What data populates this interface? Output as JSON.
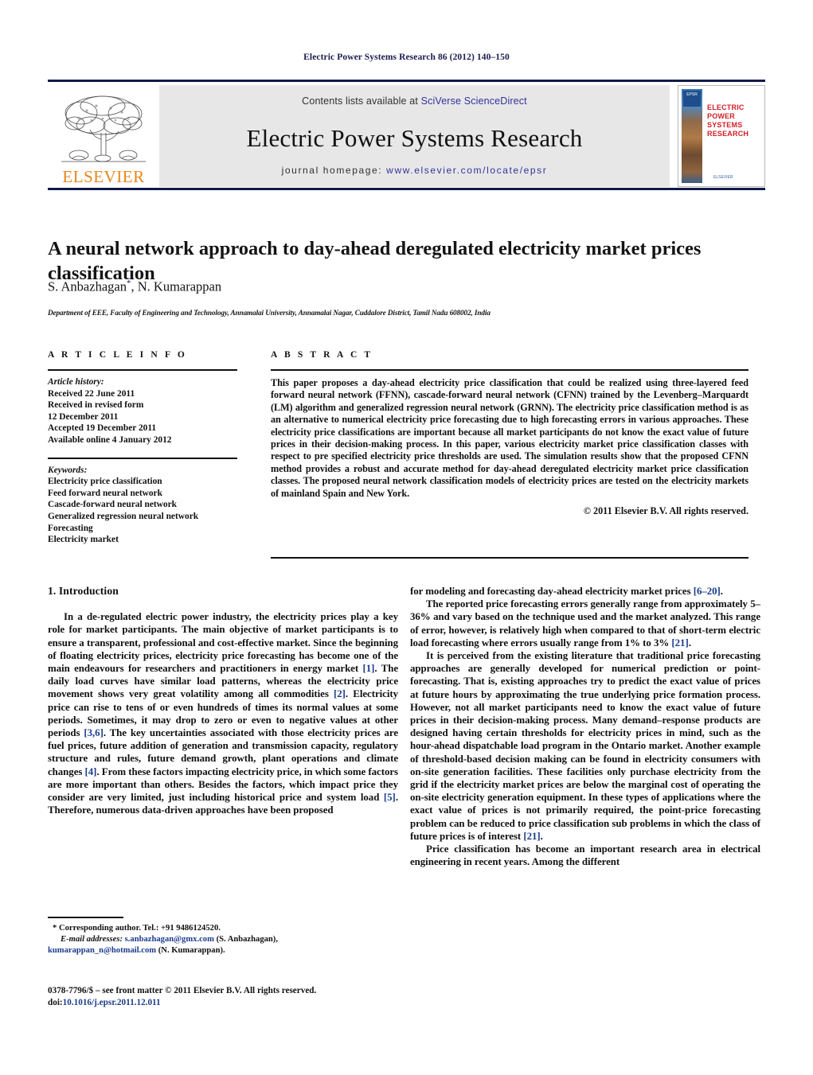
{
  "running_head": "Electric Power Systems Research 86 (2012) 140–150",
  "masthead": {
    "publisher_logo_text": "ELSEVIER",
    "contents_prefix": "Contents lists available at ",
    "contents_link": "SciVerse ScienceDirect",
    "journal_title": "Electric Power Systems Research",
    "homepage_prefix": "journal homepage: ",
    "homepage_url": "www.elsevier.com/locate/epsr",
    "cover": {
      "badge_text": "EPSR",
      "title_line1": "ELECTRIC POWER",
      "title_line2": "SYSTEMS RESEARCH",
      "footer_text": "ELSEVIER"
    }
  },
  "article": {
    "title": "A neural network approach to day-ahead deregulated electricity market prices classification",
    "authors": "S. Anbazhagan",
    "authors_rest": ", N. Kumarappan",
    "corresponding_mark": "*",
    "affiliation": "Department of EEE, Faculty of Engineering and Technology, Annamalai University, Annamalai Nagar, Cuddalore District, Tamil Nadu 608002, India"
  },
  "info": {
    "heading": "A R T I C L E   I N F O",
    "history_label": "Article history:",
    "history": [
      "Received 22 June 2011",
      "Received in revised form",
      "12 December 2011",
      "Accepted 19 December 2011",
      "Available online 4 January 2012"
    ],
    "keywords_label": "Keywords:",
    "keywords": [
      "Electricity price classification",
      "Feed forward neural network",
      "Cascade-forward neural network",
      "Generalized regression neural network",
      "Forecasting",
      "Electricity market"
    ]
  },
  "abstract": {
    "heading": "A B S T R A C T",
    "text": "This paper proposes a day-ahead electricity price classification that could be realized using three-layered feed forward neural network (FFNN), cascade-forward neural network (CFNN) trained by the Levenberg–Marquardt (LM) algorithm and generalized regression neural network (GRNN). The electricity price classification method is as an alternative to numerical electricity price forecasting due to high forecasting errors in various approaches. These electricity price classifications are important because all market participants do not know the exact value of future prices in their decision-making process. In this paper, various electricity market price classification classes with respect to pre specified electricity price thresholds are used. The simulation results show that the proposed CFNN method provides a robust and accurate method for day-ahead deregulated electricity market price classification classes. The proposed neural network classification models of electricity prices are tested on the electricity markets of mainland Spain and New York.",
    "copyright": "© 2011 Elsevier B.V. All rights reserved."
  },
  "body": {
    "section_heading": "1.  Introduction",
    "left_para_1_a": "In a de-regulated electric power industry, the electricity prices play a key role for market participants. The main objective of market participants is to ensure a transparent, professional and cost-effective market. Since the beginning of floating electricity prices, electricity price forecasting has become one of the main endeavours for researchers and practitioners in energy market ",
    "ref_1": "[1]",
    "left_para_1_b": ". The daily load curves have similar load patterns, whereas the electricity price movement shows very great volatility among all commodities ",
    "ref_2": "[2]",
    "left_para_1_c": ". Electricity price can rise to tens of or even hundreds of times its normal values at some periods. Sometimes, it may drop to zero or even to negative values at other periods ",
    "ref_36": "[3,6]",
    "left_para_1_d": ". The key uncertainties associated with those electricity prices are fuel prices, future addition of generation and transmission capacity, regulatory structure and rules, future demand growth, plant operations and climate changes ",
    "ref_4": "[4]",
    "left_para_1_e": ". From these factors impacting electricity price, in which some factors are more important than others. Besides the factors, which impact price they consider are very limited, just including historical price and system load ",
    "ref_5": "[5]",
    "left_para_1_f": ". Therefore, numerous data-driven approaches have been proposed",
    "right_cont_a": "for modeling and forecasting day-ahead electricity market prices ",
    "ref_620": "[6–20]",
    "right_cont_b": ".",
    "right_para_2_a": "The reported price forecasting errors generally range from approximately 5–36% and vary based on the technique used and the market analyzed. This range of error, however, is relatively high when compared to that of short-term electric load forecasting where errors usually range from 1% to 3% ",
    "ref_21a": "[21]",
    "right_para_2_b": ".",
    "right_para_3_a": "It is perceived from the existing literature that traditional price forecasting approaches are generally developed for numerical prediction or point-forecasting. That is, existing approaches try to predict the exact value of prices at future hours by approximating the true underlying price formation process. However, not all market participants need to know the exact value of future prices in their decision-making process. Many demand–response products are designed having certain thresholds for electricity prices in mind, such as the hour-ahead dispatchable load program in the Ontario market. Another example of threshold-based decision making can be found in electricity consumers with on-site generation facilities. These facilities only purchase electricity from the grid if the electricity market prices are below the marginal cost of operating the on-site electricity generation equipment. In these types of applications where the exact value of prices is not primarily required, the point-price forecasting problem can be reduced to price classification sub problems in which the class of future prices is of interest ",
    "ref_21b": "[21]",
    "right_para_3_b": ".",
    "right_para_4": "Price classification has become an important research area in electrical engineering in recent years. Among the different"
  },
  "footnote": {
    "corr_mark": "*",
    "corr_text": "Corresponding author. Tel.: +91 9486124520.",
    "email_label": "E-mail addresses:",
    "email_1": "s.anbazhagan@gmx.com",
    "email_1_owner": " (S. Anbazhagan),",
    "email_2": "kumarappan_n@hotmail.com",
    "email_2_owner": " (N. Kumarappan)."
  },
  "issn": {
    "line1_a": "0378-7796/$ – see front matter © 2011 Elsevier B.V. All rights reserved.",
    "doi_label": "doi:",
    "doi_value": "10.1016/j.epsr.2011.12.011"
  },
  "colors": {
    "rule_navy": "#121a4a",
    "link_blue": "#32329a",
    "ref_blue": "#1b3c8c",
    "elsevier_orange": "#E8851B",
    "band_gray": "#e7e7e8"
  }
}
